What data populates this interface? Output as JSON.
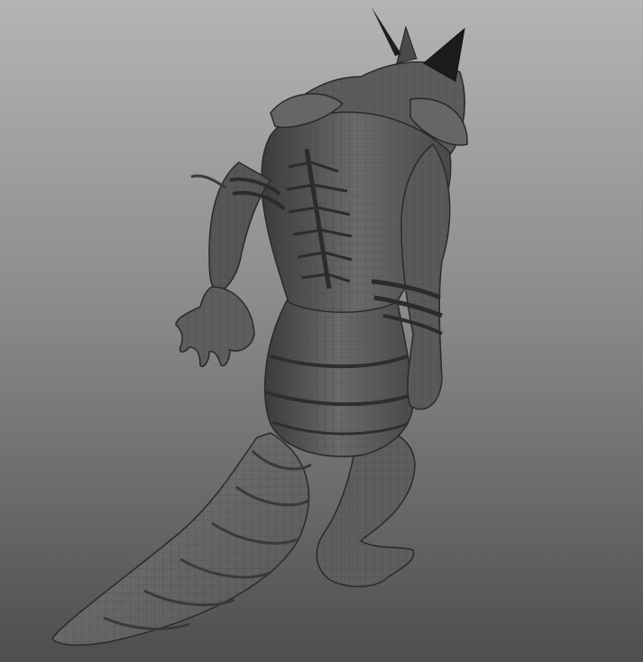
{
  "viewport": {
    "background_top": "#b4b4b4",
    "background_bottom": "#4e4e4e",
    "model_color": "#5a5a5a",
    "wireframe_color": "#2e2e2e",
    "model_name": "creature-mesh"
  }
}
